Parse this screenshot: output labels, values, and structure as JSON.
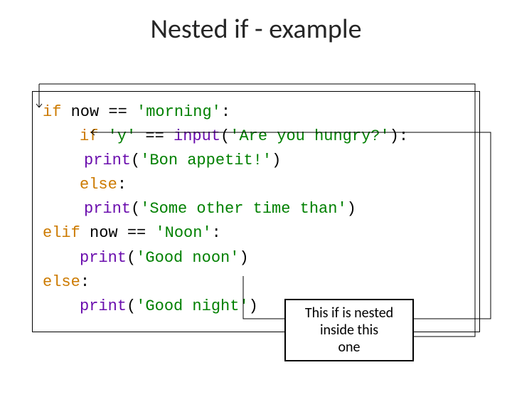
{
  "title": "Nested if - example",
  "code": {
    "l1_if": "if",
    "l1_rest1": " now == ",
    "l1_str": "'morning'",
    "l1_colon": ":",
    "l2_if": "if",
    "l2_rest1": " ",
    "l2_str1": "'y'",
    "l2_eq": " == ",
    "l2_fn": "input",
    "l2_p1": "(",
    "l2_str2": "'Are you hungry?'",
    "l2_p2": "):",
    "l3_fn": "print",
    "l3_p1": "(",
    "l3_str": "'Bon appetit!'",
    "l3_p2": ")",
    "l4_else": "else",
    "l4_colon": ":",
    "l5_fn": "print",
    "l5_p1": "(",
    "l5_str": "'Some other time than'",
    "l5_p2": ")",
    "l6_elif": "elif",
    "l6_rest": " now == ",
    "l6_str": "'Noon'",
    "l6_colon": ":",
    "l7_fn": "print",
    "l7_p1": "(",
    "l7_str": "'Good noon'",
    "l7_p2": ")",
    "l8_else": "else",
    "l8_colon": ":",
    "l9_fn": "print",
    "l9_p1": "(",
    "l9_str": "'Good night'",
    "l9_p2": ")"
  },
  "callout": {
    "line1": "This if is nested",
    "line2": "inside this",
    "line3": "one"
  }
}
